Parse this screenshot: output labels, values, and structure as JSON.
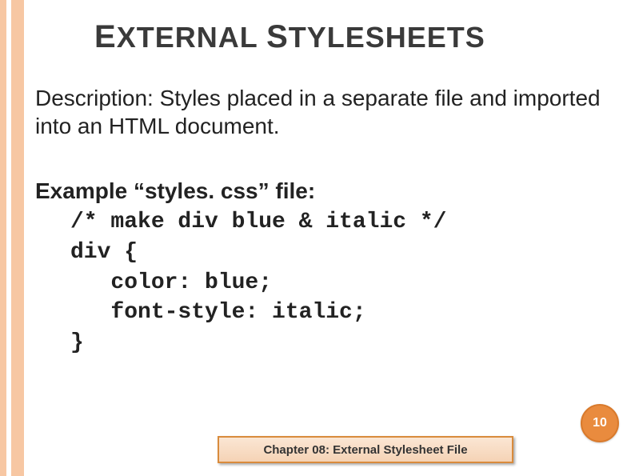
{
  "title": {
    "word1_first": "E",
    "word1_rest": "XTERNAL",
    "word2_first": "S",
    "word2_rest": "TYLESHEETS"
  },
  "description": "Description: Styles placed in a separate file and imported into an HTML document.",
  "example_label": "Example “styles. css” file:",
  "code": "/* make div blue & italic */\ndiv {\n   color: blue;\n   font-style: italic;\n}",
  "page_number": "10",
  "chapter_label": "Chapter  08: External Stylesheet File"
}
